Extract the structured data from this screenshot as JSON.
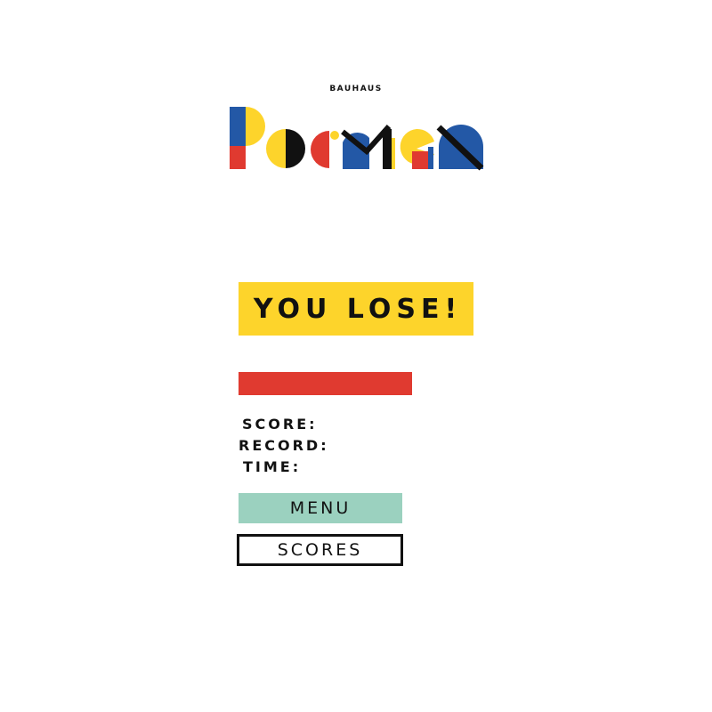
{
  "header": {
    "subtitle": "BAUHAUS",
    "logo_text": "Pacman"
  },
  "result": {
    "message": "YOU LOSE!"
  },
  "stats": {
    "score_label": "SCORE:",
    "score_value": "",
    "record_label": "RECORD:",
    "record_value": "",
    "time_label": "TIME:",
    "time_value": ""
  },
  "buttons": {
    "menu_label": "MENU",
    "scores_label": "SCORES"
  },
  "colors": {
    "yellow": "#fdd42b",
    "red": "#e03a30",
    "blue": "#2358a6",
    "mint": "#9bd1bf",
    "black": "#111111"
  }
}
